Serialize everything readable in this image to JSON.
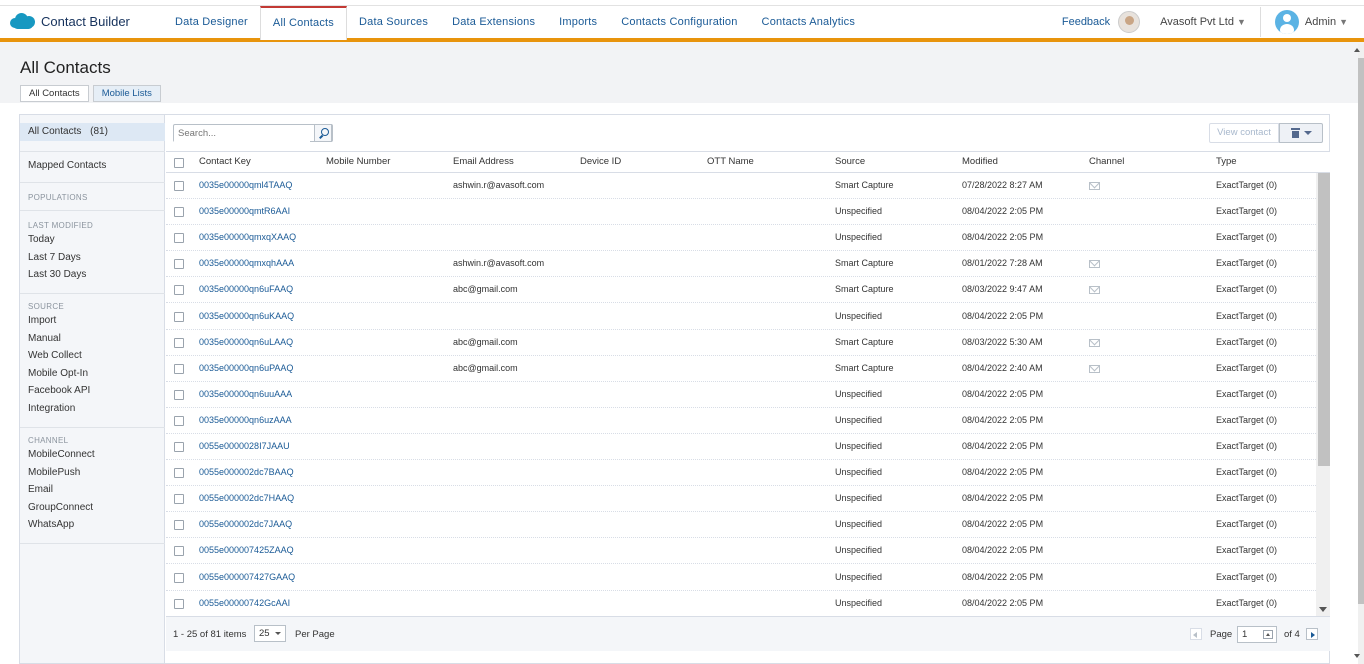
{
  "app": {
    "brand": "Contact Builder"
  },
  "nav": {
    "tabs": [
      {
        "label": "Data Designer"
      },
      {
        "label": "All Contacts"
      },
      {
        "label": "Data Sources"
      },
      {
        "label": "Data Extensions"
      },
      {
        "label": "Imports"
      },
      {
        "label": "Contacts Configuration"
      },
      {
        "label": "Contacts Analytics"
      }
    ],
    "active_tab": "All Contacts",
    "feedback": "Feedback",
    "org": "Avasoft Pvt Ltd",
    "user": "Admin"
  },
  "page": {
    "title": "All Contacts",
    "subtabs": [
      {
        "label": "All Contacts"
      },
      {
        "label": "Mobile Lists"
      }
    ]
  },
  "sidebar": {
    "all_contacts": "All Contacts",
    "all_count": "(81)",
    "mapped": "Mapped Contacts",
    "populations": "POPULATIONS",
    "last_modified": "LAST MODIFIED",
    "lm_items": [
      "Today",
      "Last 7 Days",
      "Last 30 Days"
    ],
    "source": "SOURCE",
    "source_items": [
      "Import",
      "Manual",
      "Web Collect",
      "Mobile Opt-In",
      "Facebook API",
      "Integration"
    ],
    "channel": "CHANNEL",
    "channel_items": [
      "MobileConnect",
      "MobilePush",
      "Email",
      "GroupConnect",
      "WhatsApp"
    ]
  },
  "toolbar": {
    "search_placeholder": "Search...",
    "view_contact": "View contact"
  },
  "table": {
    "columns": [
      "Contact Key",
      "Mobile Number",
      "Email Address",
      "Device ID",
      "OTT Name",
      "Source",
      "Modified",
      "Channel",
      "Type"
    ],
    "rows": [
      {
        "key": "0035e00000qml4TAAQ",
        "mobile": "",
        "email": "ashwin.r@avasoft.com",
        "device": "",
        "ott": "",
        "source": "Smart Capture",
        "modified": "07/28/2022 8:27 AM",
        "channel": "mail",
        "type": "ExactTarget (0)"
      },
      {
        "key": "0035e00000qmtR6AAI",
        "mobile": "",
        "email": "",
        "device": "",
        "ott": "",
        "source": "Unspecified",
        "modified": "08/04/2022 2:05 PM",
        "channel": "",
        "type": "ExactTarget (0)"
      },
      {
        "key": "0035e00000qmxqXAAQ",
        "mobile": "",
        "email": "",
        "device": "",
        "ott": "",
        "source": "Unspecified",
        "modified": "08/04/2022 2:05 PM",
        "channel": "",
        "type": "ExactTarget (0)"
      },
      {
        "key": "0035e00000qmxqhAAA",
        "mobile": "",
        "email": "ashwin.r@avasoft.com",
        "device": "",
        "ott": "",
        "source": "Smart Capture",
        "modified": "08/01/2022 7:28 AM",
        "channel": "mail",
        "type": "ExactTarget (0)"
      },
      {
        "key": "0035e00000qn6uFAAQ",
        "mobile": "",
        "email": "abc@gmail.com",
        "device": "",
        "ott": "",
        "source": "Smart Capture",
        "modified": "08/03/2022 9:47 AM",
        "channel": "mail",
        "type": "ExactTarget (0)"
      },
      {
        "key": "0035e00000qn6uKAAQ",
        "mobile": "",
        "email": "",
        "device": "",
        "ott": "",
        "source": "Unspecified",
        "modified": "08/04/2022 2:05 PM",
        "channel": "",
        "type": "ExactTarget (0)"
      },
      {
        "key": "0035e00000qn6uLAAQ",
        "mobile": "",
        "email": "abc@gmail.com",
        "device": "",
        "ott": "",
        "source": "Smart Capture",
        "modified": "08/03/2022 5:30 AM",
        "channel": "mail",
        "type": "ExactTarget (0)"
      },
      {
        "key": "0035e00000qn6uPAAQ",
        "mobile": "",
        "email": "abc@gmail.com",
        "device": "",
        "ott": "",
        "source": "Smart Capture",
        "modified": "08/04/2022 2:40 AM",
        "channel": "mail",
        "type": "ExactTarget (0)"
      },
      {
        "key": "0035e00000qn6uuAAA",
        "mobile": "",
        "email": "",
        "device": "",
        "ott": "",
        "source": "Unspecified",
        "modified": "08/04/2022 2:05 PM",
        "channel": "",
        "type": "ExactTarget (0)"
      },
      {
        "key": "0035e00000qn6uzAAA",
        "mobile": "",
        "email": "",
        "device": "",
        "ott": "",
        "source": "Unspecified",
        "modified": "08/04/2022 2:05 PM",
        "channel": "",
        "type": "ExactTarget (0)"
      },
      {
        "key": "0055e0000028I7JAAU",
        "mobile": "",
        "email": "",
        "device": "",
        "ott": "",
        "source": "Unspecified",
        "modified": "08/04/2022 2:05 PM",
        "channel": "",
        "type": "ExactTarget (0)"
      },
      {
        "key": "0055e000002dc7BAAQ",
        "mobile": "",
        "email": "",
        "device": "",
        "ott": "",
        "source": "Unspecified",
        "modified": "08/04/2022 2:05 PM",
        "channel": "",
        "type": "ExactTarget (0)"
      },
      {
        "key": "0055e000002dc7HAAQ",
        "mobile": "",
        "email": "",
        "device": "",
        "ott": "",
        "source": "Unspecified",
        "modified": "08/04/2022 2:05 PM",
        "channel": "",
        "type": "ExactTarget (0)"
      },
      {
        "key": "0055e000002dc7JAAQ",
        "mobile": "",
        "email": "",
        "device": "",
        "ott": "",
        "source": "Unspecified",
        "modified": "08/04/2022 2:05 PM",
        "channel": "",
        "type": "ExactTarget (0)"
      },
      {
        "key": "0055e000007425ZAAQ",
        "mobile": "",
        "email": "",
        "device": "",
        "ott": "",
        "source": "Unspecified",
        "modified": "08/04/2022 2:05 PM",
        "channel": "",
        "type": "ExactTarget (0)"
      },
      {
        "key": "0055e000007427GAAQ",
        "mobile": "",
        "email": "",
        "device": "",
        "ott": "",
        "source": "Unspecified",
        "modified": "08/04/2022 2:05 PM",
        "channel": "",
        "type": "ExactTarget (0)"
      },
      {
        "key": "0055e00000742GcAAI",
        "mobile": "",
        "email": "",
        "device": "",
        "ott": "",
        "source": "Unspecified",
        "modified": "08/04/2022 2:05 PM",
        "channel": "",
        "type": "ExactTarget (0)"
      }
    ]
  },
  "footer": {
    "items": "1 - 25 of 81 items",
    "page_size": "25",
    "per_page": "Per Page",
    "page_label": "Page",
    "page_value": "1",
    "of_pages": "of 4"
  },
  "icons": [
    "salesforce-cloud-icon",
    "search-icon",
    "trash-icon",
    "mail-icon",
    "chevron-left-icon",
    "chevron-right-icon"
  ]
}
